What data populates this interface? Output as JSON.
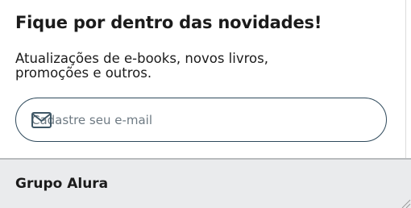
{
  "newsletter": {
    "title": "Fique por dentro das novidades!",
    "description": "Atualizações de e-books, novos livros, promoções e outros.",
    "email_placeholder": "Cadastre seu e-mail",
    "email_value": "",
    "icon": "envelope-icon"
  },
  "footer": {
    "title": "Grupo Alura"
  },
  "colors": {
    "text": "#1b1b1b",
    "input_border": "#2f4a5c",
    "placeholder": "#6e7a83",
    "footer_bg": "#eaebed"
  }
}
